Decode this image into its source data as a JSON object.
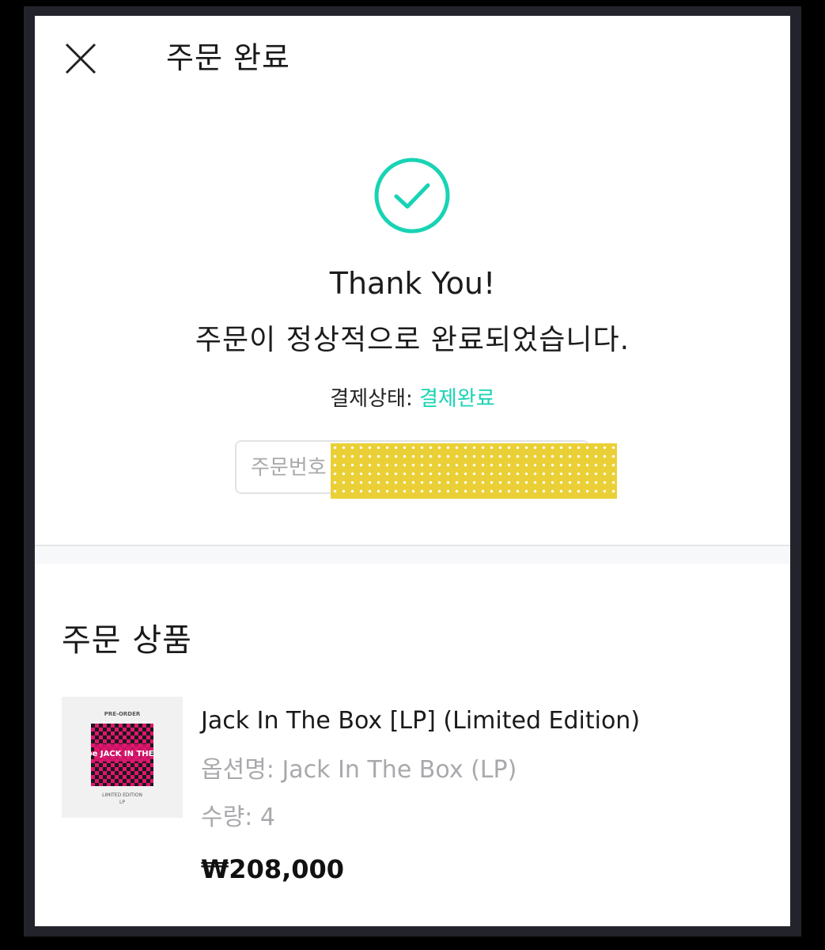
{
  "header": {
    "title": "주문 완료",
    "close_icon": "close-icon"
  },
  "confirmation": {
    "icon": "check-circle-icon",
    "icon_color": "#18d3b4",
    "thanks": "Thank You!",
    "message": "주문이 정상적으로 완료되었습니다.",
    "payment_status_label": "결제상태: ",
    "payment_status_value": "결제완료",
    "order_number_label": "주문번호"
  },
  "order_items": {
    "title": "주문 상품",
    "items": [
      {
        "thumbnail": {
          "top_text": "PRE-ORDER",
          "art_text": "J-hope JACK IN THE BOX",
          "bottom_text_1": "LIMITED EDITION",
          "bottom_text_2": "LP"
        },
        "name": "Jack In The Box [LP] (Limited Edition)",
        "option": "옵션명: Jack In The Box (LP)",
        "quantity": "수량: 4",
        "price": "₩208,000"
      }
    ]
  },
  "colors": {
    "accent": "#18d3b4",
    "muted_text": "#a9a9ad",
    "redaction": "#ead036"
  }
}
